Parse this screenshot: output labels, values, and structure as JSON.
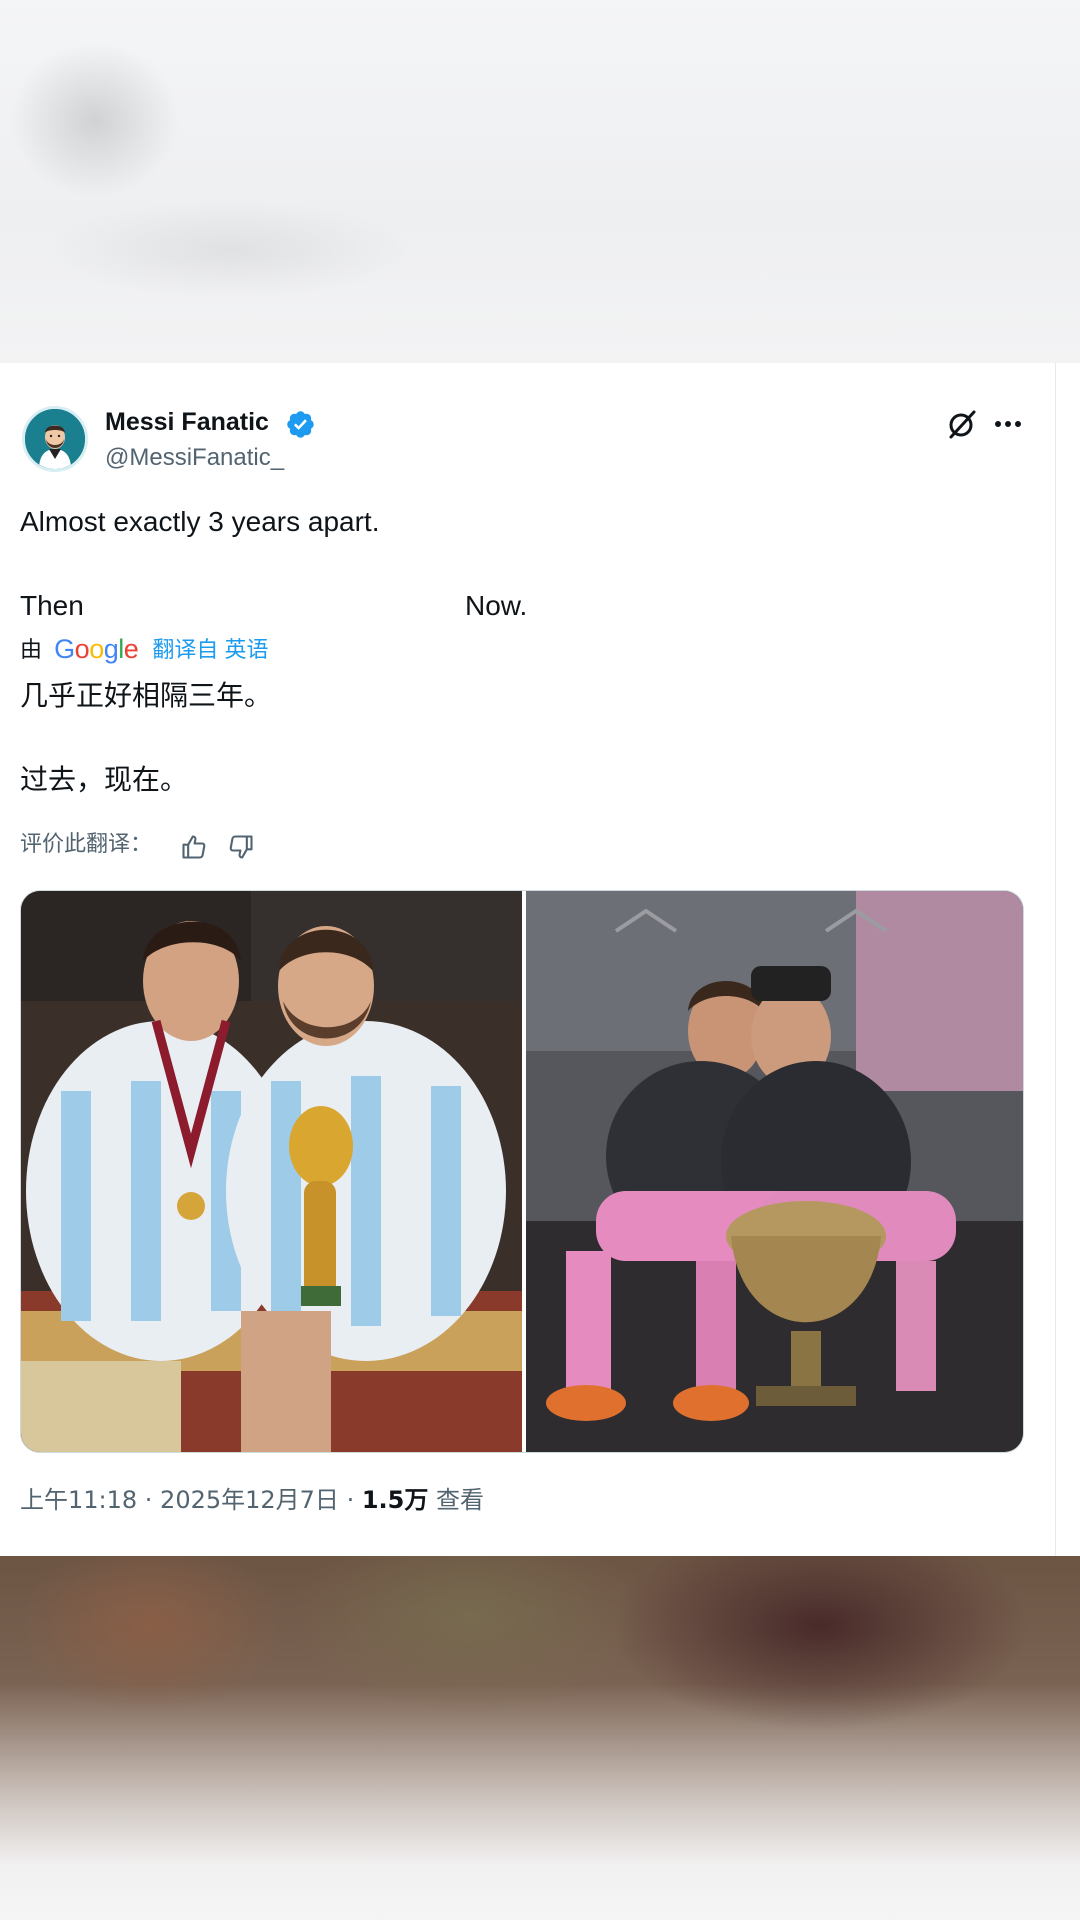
{
  "tweet": {
    "display_name": "Messi Fanatic",
    "handle": "@MessiFanatic_",
    "text_line1": "Almost exactly 3 years apart.",
    "text_then": "Then",
    "text_now": "Now.",
    "translation": {
      "by_label": "由",
      "google_logo": "Google",
      "from_label": "翻译自 英语",
      "line1": "几乎正好相隔三年。",
      "line2": "过去，现在。",
      "rate_label": "评价此翻译："
    },
    "meta": {
      "time": "上午11:18 · 2025年12月7日 · ",
      "views_count": "1.5万",
      "views_label": " 查看"
    },
    "icons": {
      "verified": "verified-badge-icon",
      "grok": "grok-icon",
      "more": "more-icon",
      "thumb_up": "thumbs-up-icon",
      "thumb_down": "thumbs-down-icon"
    },
    "colors": {
      "accent": "#1d9bf0",
      "secondary_text": "#536471",
      "primary_text": "#0f1419"
    }
  }
}
